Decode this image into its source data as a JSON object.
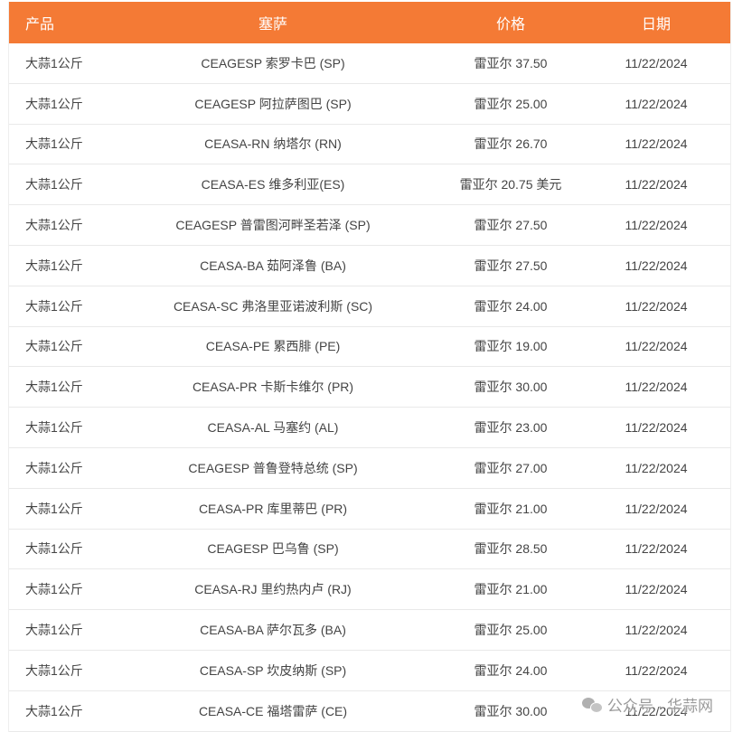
{
  "table": {
    "headers": [
      "产品",
      "塞萨",
      "价格",
      "日期"
    ],
    "rows": [
      [
        "大蒜1公斤",
        "CEAGESP 索罗卡巴 (SP)",
        "雷亚尔 37.50",
        "11/22/2024"
      ],
      [
        "大蒜1公斤",
        "CEAGESP 阿拉萨图巴 (SP)",
        "雷亚尔 25.00",
        "11/22/2024"
      ],
      [
        "大蒜1公斤",
        "CEASA-RN 纳塔尔 (RN)",
        "雷亚尔 26.70",
        "11/22/2024"
      ],
      [
        "大蒜1公斤",
        "CEASA-ES 维多利亚(ES)",
        "雷亚尔 20.75 美元",
        "11/22/2024"
      ],
      [
        "大蒜1公斤",
        "CEAGESP 普雷图河畔圣若泽 (SP)",
        "雷亚尔 27.50",
        "11/22/2024"
      ],
      [
        "大蒜1公斤",
        "CEASA-BA 茹阿泽鲁 (BA)",
        "雷亚尔 27.50",
        "11/22/2024"
      ],
      [
        "大蒜1公斤",
        "CEASA-SC 弗洛里亚诺波利斯 (SC)",
        "雷亚尔 24.00",
        "11/22/2024"
      ],
      [
        "大蒜1公斤",
        "CEASA-PE 累西腓 (PE)",
        "雷亚尔 19.00",
        "11/22/2024"
      ],
      [
        "大蒜1公斤",
        "CEASA-PR 卡斯卡维尔 (PR)",
        "雷亚尔 30.00",
        "11/22/2024"
      ],
      [
        "大蒜1公斤",
        "CEASA-AL 马塞约 (AL)",
        "雷亚尔 23.00",
        "11/22/2024"
      ],
      [
        "大蒜1公斤",
        "CEAGESP 普鲁登特总统 (SP)",
        "雷亚尔 27.00",
        "11/22/2024"
      ],
      [
        "大蒜1公斤",
        "CEASA-PR 库里蒂巴 (PR)",
        "雷亚尔 21.00",
        "11/22/2024"
      ],
      [
        "大蒜1公斤",
        "CEAGESP 巴乌鲁 (SP)",
        "雷亚尔 28.50",
        "11/22/2024"
      ],
      [
        "大蒜1公斤",
        "CEASA-RJ 里约热内卢 (RJ)",
        "雷亚尔 21.00",
        "11/22/2024"
      ],
      [
        "大蒜1公斤",
        "CEASA-BA 萨尔瓦多 (BA)",
        "雷亚尔 25.00",
        "11/22/2024"
      ],
      [
        "大蒜1公斤",
        "CEASA-SP 坎皮纳斯 (SP)",
        "雷亚尔 24.00",
        "11/22/2024"
      ],
      [
        "大蒜1公斤",
        "CEASA-CE 福塔雷萨 (CE)",
        "雷亚尔 30.00",
        "11/22/2024"
      ]
    ]
  },
  "watermark": {
    "icon": "wechat-icon",
    "text": "公众号 · 华蒜网"
  },
  "colors": {
    "header_bg": "#f47a35",
    "header_text": "#ffffff",
    "row_text": "#444444"
  }
}
